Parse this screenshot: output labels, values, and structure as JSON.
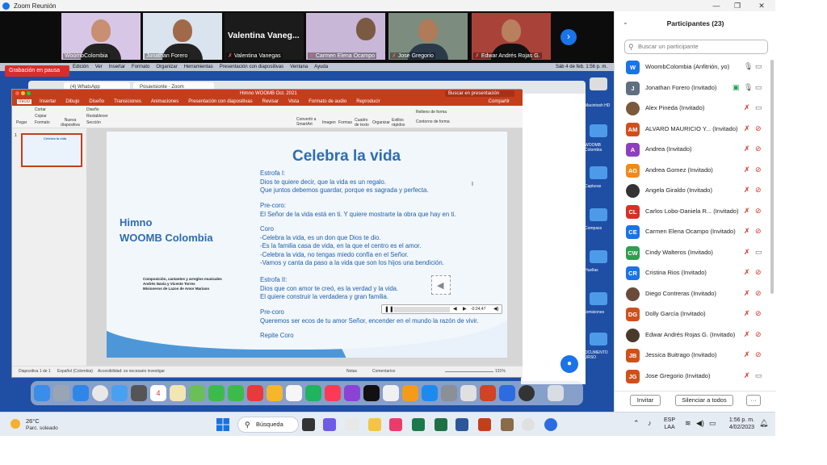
{
  "window": {
    "title": "Zoom Reunión",
    "controls": [
      "—",
      "❐",
      "✕"
    ]
  },
  "video_strip": {
    "tiles": [
      {
        "label": "WoombColombia",
        "muted": false,
        "face": "#c98f73",
        "bg": "#d8c6e6"
      },
      {
        "label": "Jonathan Forero",
        "muted": false,
        "face": "#a06a4a",
        "bg": "#d9e4ef"
      },
      {
        "label": "Valentina Vanegas",
        "muted": true,
        "name_only": "Valentina Vaneg...",
        "bg": "#222222"
      },
      {
        "label": "Carmen Elena Ocampo",
        "muted": true,
        "face": "#7b5a44",
        "bg": "#c9b7d8"
      },
      {
        "label": "Jose Gregorio",
        "muted": true,
        "face": "#b07b59",
        "bg": "#7c8c7e"
      },
      {
        "label": "Edwar Andrés Rojas G.",
        "muted": true,
        "face": "#b8805e",
        "bg": "#a9433a"
      }
    ]
  },
  "recording_badge": "Grabación en pausa",
  "mac_menu": [
    "Edición",
    "Ver",
    "Insertar",
    "Formato",
    "Organizar",
    "Herramientas",
    "Presentación con diapositivas",
    "Ventana",
    "Ayuda"
  ],
  "mac_clock": "Sáb 4 de feb. 1:56 p. m.",
  "browser": {
    "tabs": [
      "(4) WhatsApp",
      "Posavisionte - Zoom"
    ]
  },
  "desktop_labels": [
    "Macintosh HD",
    "WOOMB Colombia",
    "Capturas",
    "Compass",
    "Huellas",
    "Comisiones",
    "DOCUMENTO CURSO"
  ],
  "ppt": {
    "title": "Himno WOOMB Oct. 2021",
    "search_placeholder": "Buscar en presentación",
    "tabs": [
      "Inicio",
      "Insertar",
      "Dibujo",
      "Diseño",
      "Transiciones",
      "Animaciones",
      "Presentación con diapositivas",
      "Revisar",
      "Vista",
      "Formato de audio",
      "Reproducir"
    ],
    "share_label": "Compartir",
    "ribbon": {
      "paste": "Pegar",
      "cut": "Cortar",
      "copy": "Copiar",
      "format": "Formato",
      "new_slide": "Nueva diapositiva",
      "layout": "Diseño",
      "reset": "Restablecer",
      "section": "Sección",
      "convert": "Convertir a SmartArt",
      "image": "Imagen",
      "shapes": "Formas",
      "textbox": "Cuadro de texto",
      "arrange": "Organizar",
      "styles": "Estilos rápidos",
      "fill": "Relleno de forma",
      "outline": "Contorno de forma"
    },
    "slide": {
      "title": "Celebra la vida",
      "hymn_line1": "Himno",
      "hymn_line2": "WOOMB Colombia",
      "credits": [
        "Composición, cantantes y arreglos musicales",
        "Andrés Navia y Vicente Torres",
        "Misioneros de Lazos de Amor Mariano"
      ],
      "blocks": [
        {
          "head": "Estrofa I:",
          "lines": [
            "Dios te quiere decir, que la vida es un regalo.",
            "Que juntos debemos guardar, porque es sagrada y perfecta."
          ]
        },
        {
          "head": "Pre-coro:",
          "lines": [
            "El Señor de la vida está en ti. Y quiere mostrarte la obra que hay en ti."
          ]
        },
        {
          "head": "Coro",
          "lines": [
            "-Celebra la vida, es un don que Dios te dio.",
            "-Es la familia casa de vida, en la que el centro es el amor.",
            "-Celebra la vida, no tengas miedo confía en el Señor.",
            "-Vamos y canta da paso a la vida que son los hijos una bendición."
          ]
        },
        {
          "head": "Estrofa II:",
          "lines": [
            "Dios que con amor te creó, es la verdad y la vida.",
            "El quiere construir la verdadera y gran familia."
          ]
        },
        {
          "head": "Pre-coro",
          "lines": [
            "Queremos ser ecos de tu amor Señor, encender en el mundo la razón de vivir."
          ]
        },
        {
          "head": "Repite Coro",
          "lines": []
        }
      ],
      "audio_time": "-0:24,47"
    },
    "status": {
      "slide": "Diapositiva 1 de 1",
      "lang": "Español (Colombia)",
      "access": "Accesibilidad: es necesario investigar",
      "notes": "Notas",
      "comments": "Comentarios",
      "zoom": "131%"
    }
  },
  "participants": {
    "title": "Participantes (23)",
    "search_placeholder": "Buscar un participante",
    "list": [
      {
        "initials": "W",
        "name": "WoombColombia (Anfitrión, yo)",
        "color": "#1a73e8",
        "mic_on": true,
        "cam_on": true
      },
      {
        "initials": "J",
        "name": "Jonathan Forero (Invitado)",
        "color": "#5f6f7f",
        "mic_on": true,
        "cam_on": true,
        "sharing": true
      },
      {
        "initials": "AP",
        "name": "Alex Pineda (Invitado)",
        "color": "#7a5a3a",
        "mic_on": false,
        "cam_on": true,
        "photo": true
      },
      {
        "initials": "AM",
        "name": "ALVARO MAURICIO Y...  (Invitado)",
        "color": "#d0501c",
        "mic_on": false,
        "cam_on": false
      },
      {
        "initials": "A",
        "name": "Andrea (Invitado)",
        "color": "#8e3fbf",
        "mic_on": false,
        "cam_on": false
      },
      {
        "initials": "AG",
        "name": "Andrea Gomez (Invitado)",
        "color": "#ef8a1a",
        "mic_on": false,
        "cam_on": false
      },
      {
        "initials": "AG",
        "name": "Angela Giraldo (Invitado)",
        "color": "#333333",
        "mic_on": false,
        "cam_on": false,
        "photo": true
      },
      {
        "initials": "CL",
        "name": "Carlos Lobo-Daniela R...  (Invitado)",
        "color": "#d93025",
        "mic_on": false,
        "cam_on": false
      },
      {
        "initials": "CE",
        "name": "Carmen Elena Ocampo (Invitado)",
        "color": "#1a73e8",
        "mic_on": false,
        "cam_on": false
      },
      {
        "initials": "CW",
        "name": "Cindy Walteros (Invitado)",
        "color": "#2e9e4f",
        "mic_on": false,
        "cam_on": true
      },
      {
        "initials": "CR",
        "name": "Cristina Rios (Invitado)",
        "color": "#1a73e8",
        "mic_on": false,
        "cam_on": false
      },
      {
        "initials": "DC",
        "name": "Diego Contreras (Invitado)",
        "color": "#6a4b3a",
        "mic_on": false,
        "cam_on": false,
        "photo": true
      },
      {
        "initials": "DG",
        "name": "Dolly García (Invitado)",
        "color": "#d0501c",
        "mic_on": false,
        "cam_on": false
      },
      {
        "initials": "ER",
        "name": "Edwar Andrés Rojas G. (Invitado)",
        "color": "#4a3a2a",
        "mic_on": false,
        "cam_on": false,
        "photo": true
      },
      {
        "initials": "JB",
        "name": "Jessica Buitrago (Invitado)",
        "color": "#d0501c",
        "mic_on": false,
        "cam_on": false
      },
      {
        "initials": "JG",
        "name": "Jose Gregorio (Invitado)",
        "color": "#d0501c",
        "mic_on": false,
        "cam_on": true
      }
    ],
    "invite": "Invitar",
    "mute_all": "Silenciar a todos",
    "more": "···"
  },
  "taskbar": {
    "temp": "26°C",
    "weather": "Parc. soleado",
    "search": "Búsqueda",
    "lang_top": "ESP",
    "lang_bottom": "LAA",
    "time": "1:56 p. m.",
    "date": "4/02/2023"
  }
}
